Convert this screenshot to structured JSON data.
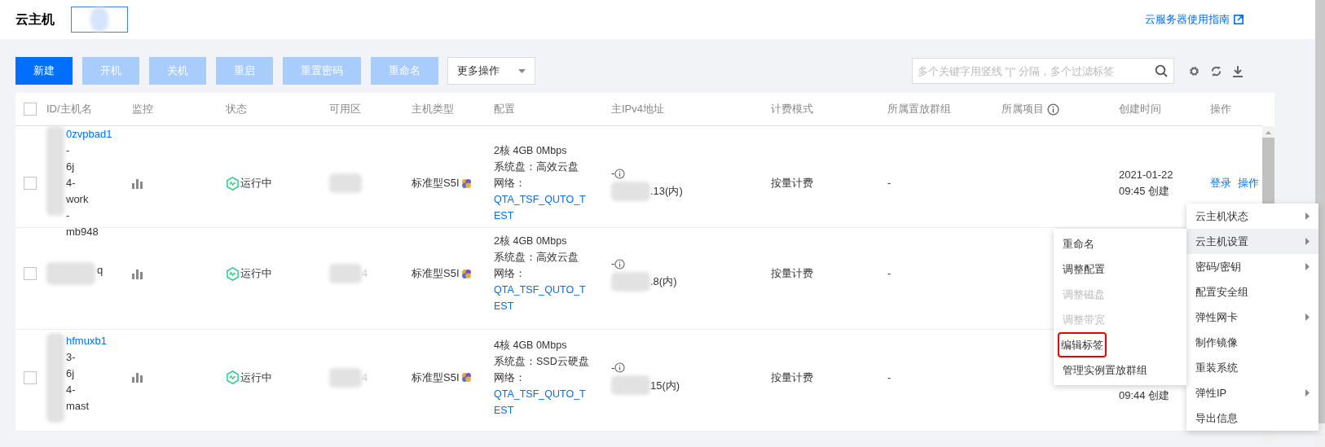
{
  "header": {
    "title": "云主机",
    "guide_link": "云服务器使用指南"
  },
  "toolbar": {
    "buttons": [
      {
        "label": "新建",
        "disabled": false
      },
      {
        "label": "开机",
        "disabled": true
      },
      {
        "label": "关机",
        "disabled": true
      },
      {
        "label": "重启",
        "disabled": true
      },
      {
        "label": "重置密码",
        "disabled": true
      },
      {
        "label": "重命名",
        "disabled": true
      }
    ],
    "more_dropdown": "更多操作",
    "search": {
      "placeholder": "多个关键字用竖线 \"|\" 分隔，多个过滤标签"
    }
  },
  "table": {
    "select_all_checked": false,
    "columns": [
      {
        "label": "ID/主机名"
      },
      {
        "label": "监控"
      },
      {
        "label": "状态"
      },
      {
        "label": "可用区"
      },
      {
        "label": "主机类型"
      },
      {
        "label": "配置"
      },
      {
        "label": "主IPv4地址"
      },
      {
        "label": "计费模式"
      },
      {
        "label": "所属置放群组"
      },
      {
        "label": "所属项目",
        "info": true
      },
      {
        "label": "创建时间"
      },
      {
        "label": "操作"
      }
    ],
    "rows": [
      {
        "checked": false,
        "id": "0zvpbad1",
        "name_lines": [
          "-",
          "6j",
          "4-",
          "work",
          "-",
          "mb948"
        ],
        "status": "运行中",
        "zone": "",
        "type": "标准型S5I",
        "config": [
          "2核 4GB 0Mbps",
          "系统盘：高效云盘",
          "网络："
        ],
        "network": "QTA_TSF_QUTO_TEST",
        "ip_prefix": "-",
        "ip": ".13(内)",
        "billing": "按量计费",
        "group": "-",
        "created": [
          "2021-01-22",
          "09:45 创建"
        ],
        "actions": [
          "登录",
          "操作"
        ]
      },
      {
        "checked": false,
        "id": "",
        "name_lines": [
          "q"
        ],
        "status": "运行中",
        "zone": "4",
        "type": "标准型S5I",
        "config": [
          "2核 4GB 0Mbps",
          "系统盘：高效云盘",
          "网络："
        ],
        "network": "QTA_TSF_QUTO_TEST",
        "ip_prefix": "-",
        "ip": ".8(内)",
        "billing": "按量计费",
        "group": "-",
        "created": [],
        "actions": []
      },
      {
        "checked": false,
        "id": "hfmuxb1",
        "name_lines": [
          "3-",
          "6j",
          "4-",
          "mast"
        ],
        "status": "运行中",
        "zone": "4",
        "type": "标准型S5I",
        "config": [
          "4核 4GB 0Mbps",
          "系统盘：SSD云硬盘",
          "网络："
        ],
        "network": "QTA_TSF_QUTO_TEST",
        "ip_prefix": "-",
        "ip": "15(内)",
        "billing": "按量计费",
        "group": "-",
        "created": [
          "09:44 创建"
        ],
        "actions": []
      }
    ]
  },
  "context_menu": {
    "items": [
      {
        "label": "云主机状态",
        "submenu": true,
        "selected": false
      },
      {
        "label": "云主机设置",
        "submenu": true,
        "selected": true
      },
      {
        "label": "密码/密钥",
        "submenu": true,
        "selected": false
      },
      {
        "label": "配置安全组",
        "submenu": false,
        "selected": false
      },
      {
        "label": "弹性网卡",
        "submenu": true,
        "selected": false
      },
      {
        "label": "制作镜像",
        "submenu": false,
        "selected": false
      },
      {
        "label": "重装系统",
        "submenu": false,
        "selected": false
      },
      {
        "label": "弹性IP",
        "submenu": true,
        "selected": false
      },
      {
        "label": "导出信息",
        "submenu": false,
        "selected": false
      }
    ],
    "submenu": [
      {
        "label": "重命名",
        "disabled": false,
        "highlighted": false
      },
      {
        "label": "调整配置",
        "disabled": false,
        "highlighted": false
      },
      {
        "label": "调整磁盘",
        "disabled": true,
        "highlighted": false
      },
      {
        "label": "调整带宽",
        "disabled": true,
        "highlighted": false
      },
      {
        "label": "编辑标签",
        "disabled": false,
        "highlighted": true
      },
      {
        "label": "管理实例置放群组",
        "disabled": false,
        "highlighted": false
      }
    ]
  }
}
